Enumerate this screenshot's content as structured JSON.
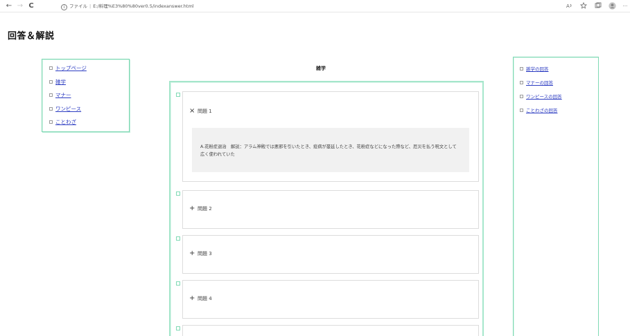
{
  "browser": {
    "back": "←",
    "forward": "→",
    "reload": "C",
    "info": "i",
    "scheme_label": "ファイル",
    "separator": "|",
    "url": "E:/料理%E3%80%80ver0.5/indexanswer.html",
    "icons": [
      "read-aloud-icon",
      "favorite-icon",
      "collections-icon",
      "profile-icon",
      "more-icon"
    ],
    "more": "···"
  },
  "page": {
    "title": "回答＆解説"
  },
  "left_nav": {
    "items": [
      {
        "label": "トップページ"
      },
      {
        "label": "雑学"
      },
      {
        "label": "マナー"
      },
      {
        "label": "ワンピース"
      },
      {
        "label": "ことわざ"
      }
    ]
  },
  "main": {
    "heading": "雑学",
    "questions": [
      {
        "symbol": "×",
        "label": "問題 1",
        "expanded": true,
        "answer": "A.花粉症退治　解説：アラム神殿では悪邪を引いたとき、疫病が蔓延したとき、花粉症などになった際など、厄災を払う呪文として広く使われていた"
      },
      {
        "symbol": "+",
        "label": "問題 2",
        "expanded": false
      },
      {
        "symbol": "+",
        "label": "問題 3",
        "expanded": false
      },
      {
        "symbol": "+",
        "label": "問題 4",
        "expanded": false
      }
    ]
  },
  "right_nav": {
    "items": [
      {
        "label": "雑学の回答"
      },
      {
        "label": "マナーの回答"
      },
      {
        "label": "ワンピースの回答"
      },
      {
        "label": "ことわざの回答"
      }
    ]
  },
  "colors": {
    "accent_border": "#7fd9b4",
    "link": "#2c3cc2",
    "answer_bg": "#f1f1f1"
  }
}
